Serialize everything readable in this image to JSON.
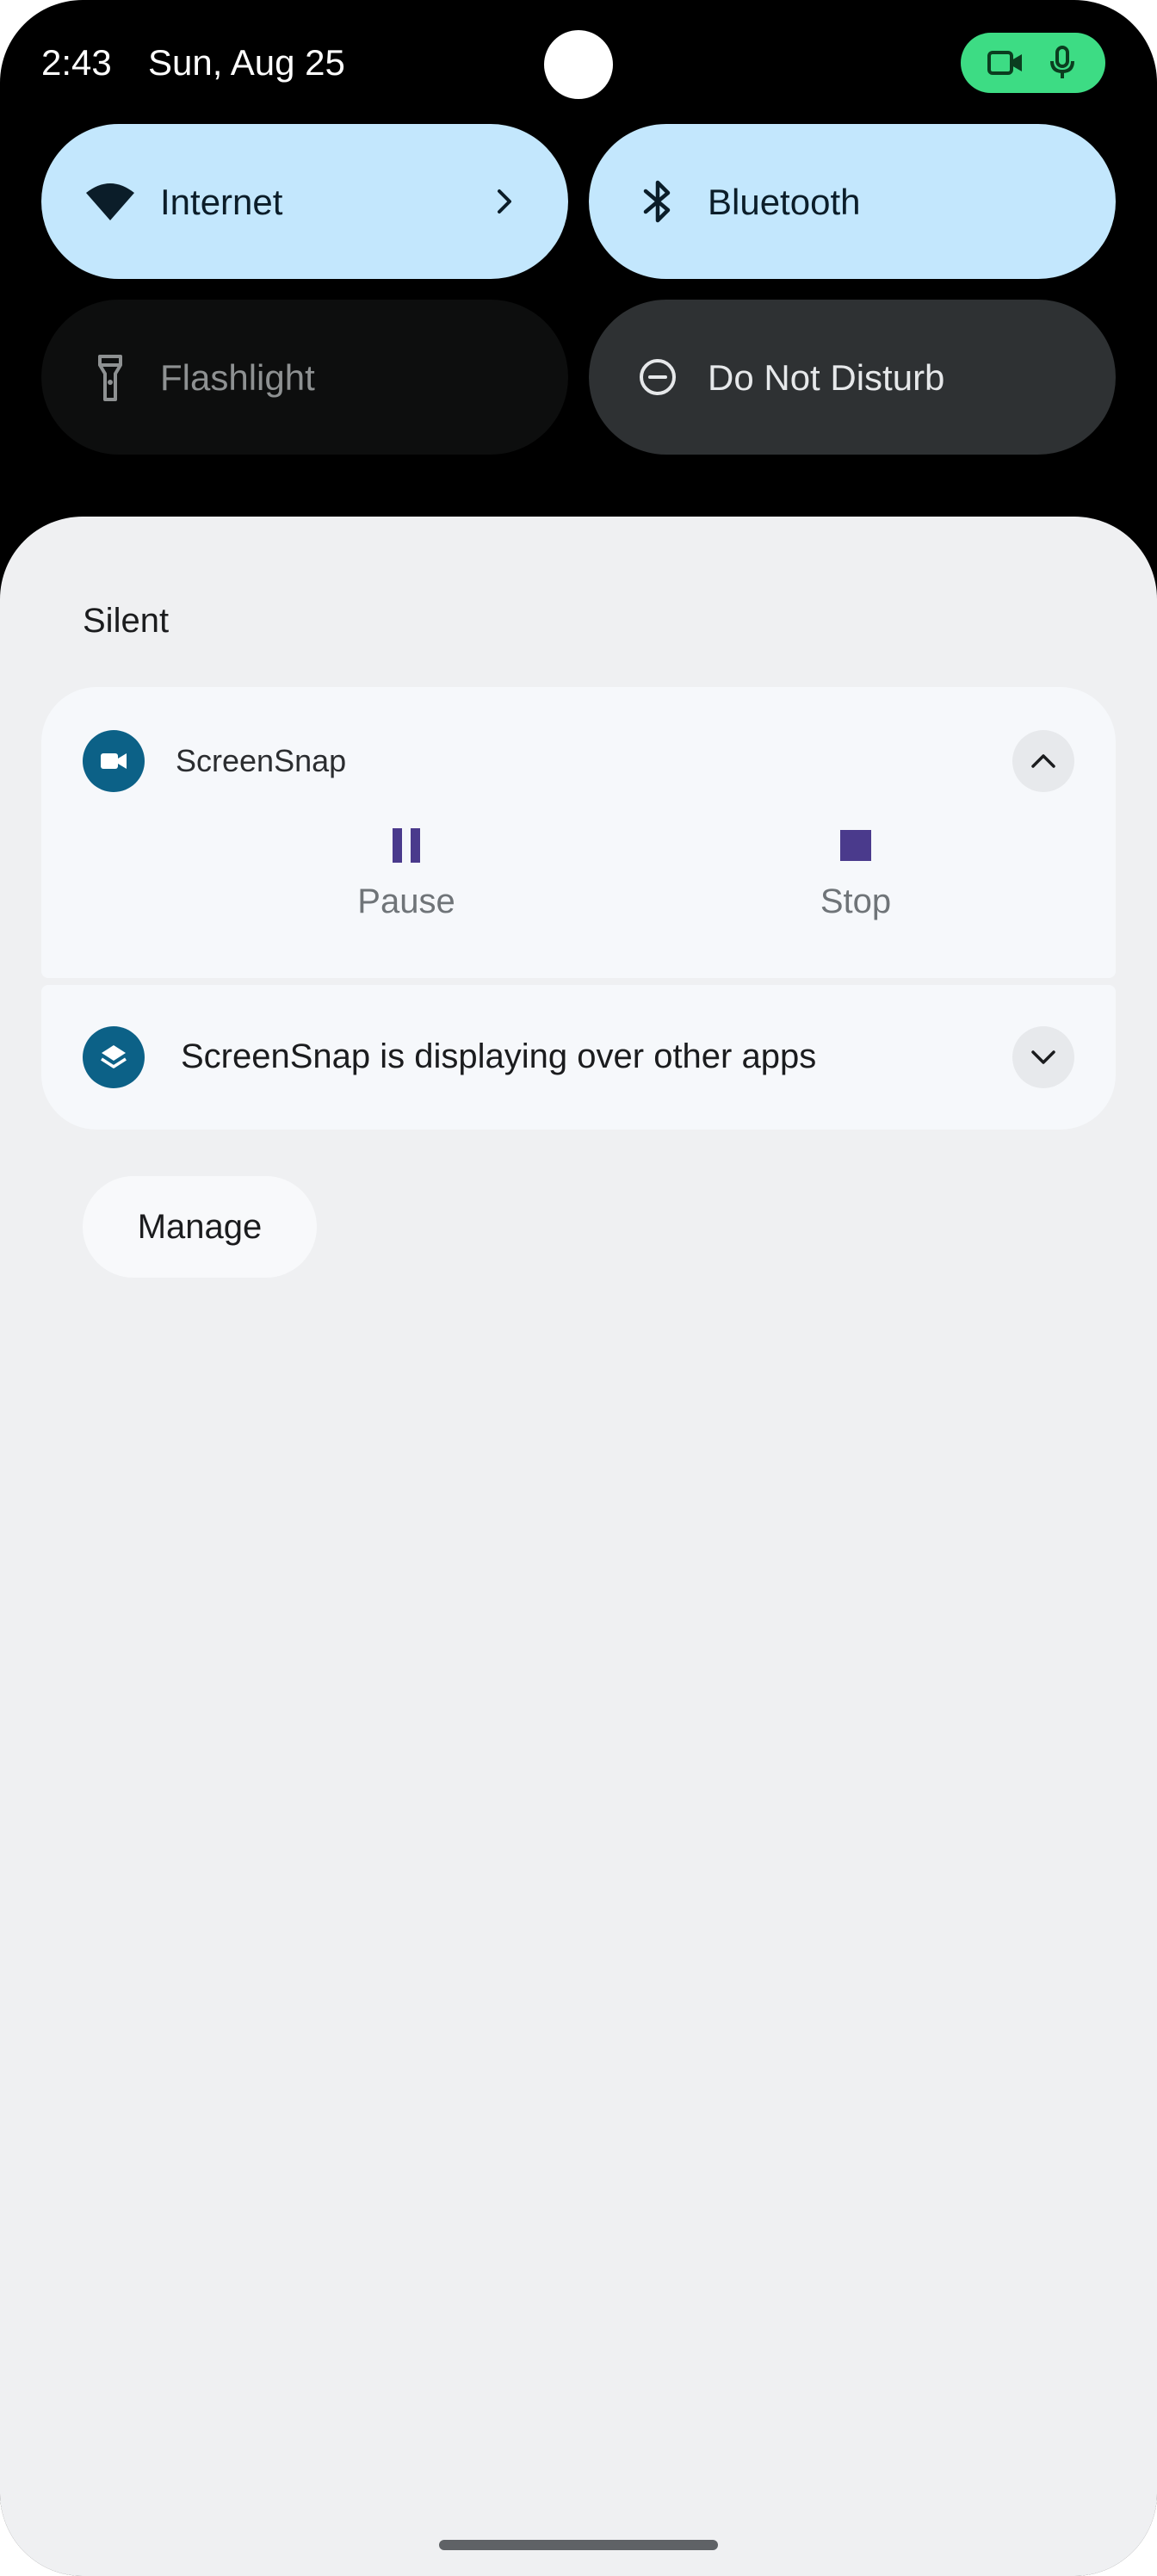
{
  "status_bar": {
    "time": "2:43",
    "date": "Sun, Aug 25",
    "privacy_chip_color": "#3ddc84",
    "privacy_icons": [
      "videocam-icon",
      "mic-icon"
    ]
  },
  "quick_settings": {
    "tiles": [
      {
        "label": "Internet",
        "icon": "wifi-icon",
        "state": "on",
        "has_chevron": true
      },
      {
        "label": "Bluetooth",
        "icon": "bluetooth-icon",
        "state": "on"
      },
      {
        "label": "Flashlight",
        "icon": "flashlight-icon",
        "state": "off"
      },
      {
        "label": "Do Not Disturb",
        "icon": "do-not-disturb-icon",
        "state": "off"
      }
    ]
  },
  "shade": {
    "section_title": "Silent",
    "recording_notification": {
      "app_name": "ScreenSnap",
      "app_icon": "videocam-icon",
      "accent_color": "#0c6187",
      "expanded": true,
      "actions": [
        {
          "label": "Pause",
          "icon": "pause-icon",
          "color": "#4a3a8c"
        },
        {
          "label": "Stop",
          "icon": "stop-icon",
          "color": "#4a3a8c"
        }
      ]
    },
    "overlay_notification": {
      "text": "ScreenSnap is displaying over other apps",
      "app_icon": "layers-icon",
      "expanded": false
    },
    "manage_label": "Manage"
  }
}
